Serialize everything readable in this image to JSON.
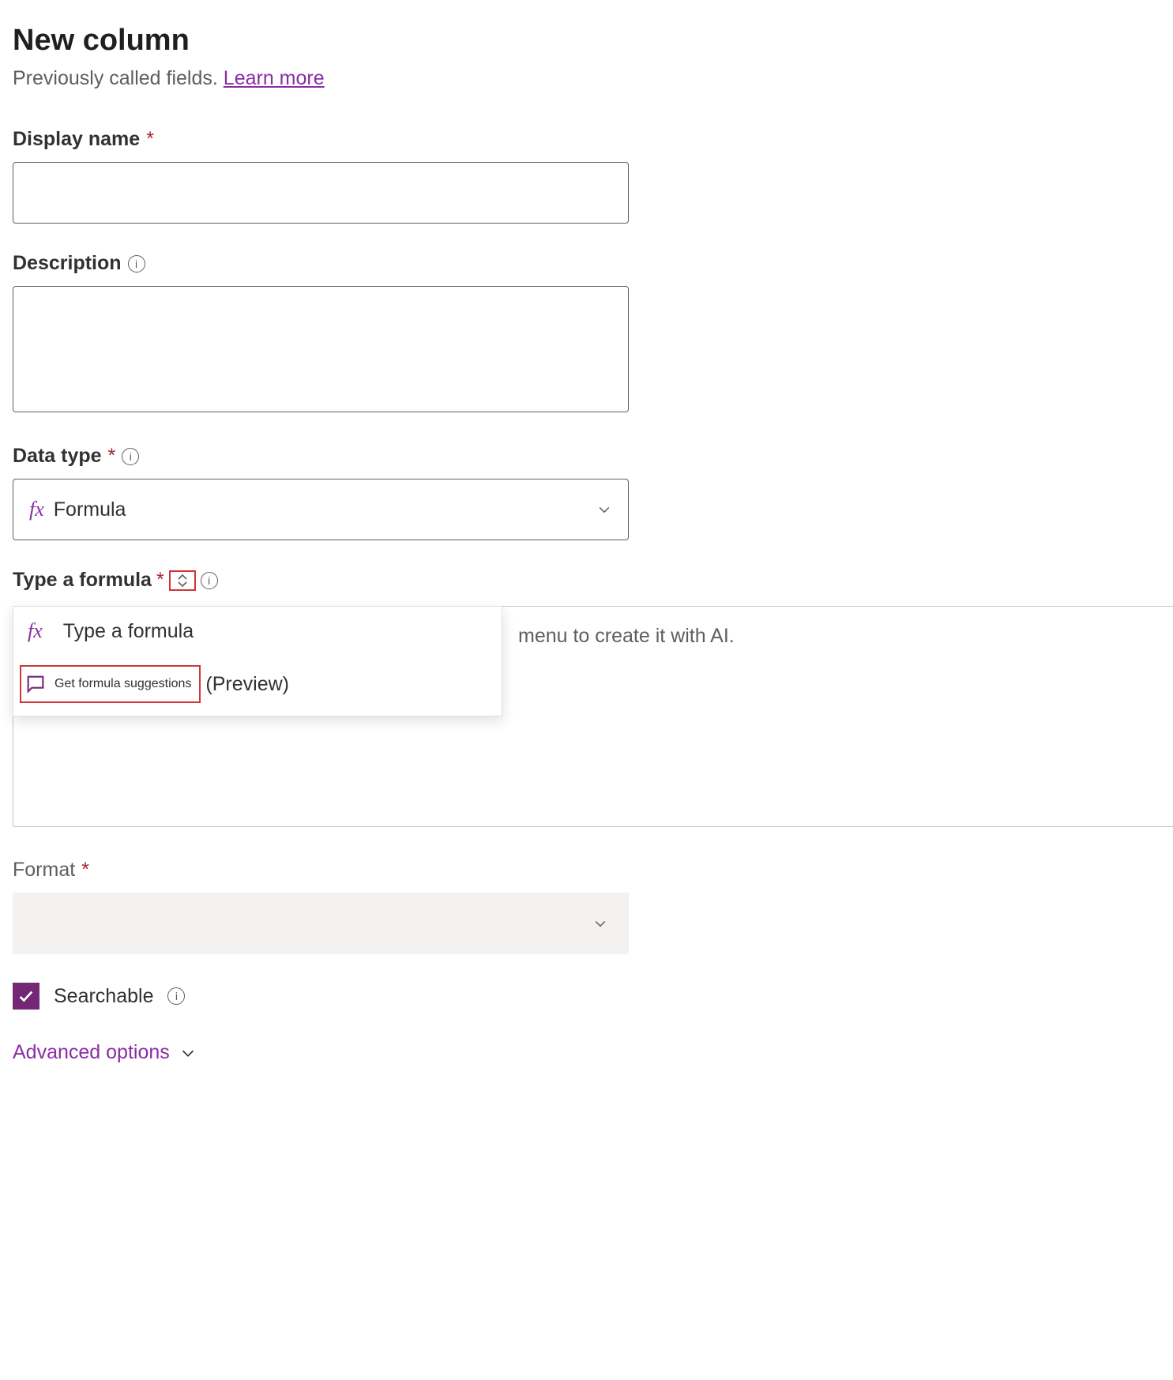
{
  "header": {
    "title": "New column",
    "subtitle_prefix": "Previously called fields. ",
    "learn_more": "Learn more"
  },
  "fields": {
    "display_name": {
      "label": "Display name",
      "value": ""
    },
    "description": {
      "label": "Description",
      "value": ""
    },
    "data_type": {
      "label": "Data type",
      "value": "Formula"
    },
    "formula": {
      "label": "Type a formula",
      "placeholder": "menu to create it with AI."
    },
    "format": {
      "label": "Format",
      "value": ""
    },
    "searchable": {
      "label": "Searchable",
      "checked": true
    }
  },
  "dropdown": {
    "item1_label": "Type a formula",
    "item2_label": "Get formula suggestions",
    "item2_suffix": "(Preview)"
  },
  "advanced": {
    "label": "Advanced options"
  }
}
